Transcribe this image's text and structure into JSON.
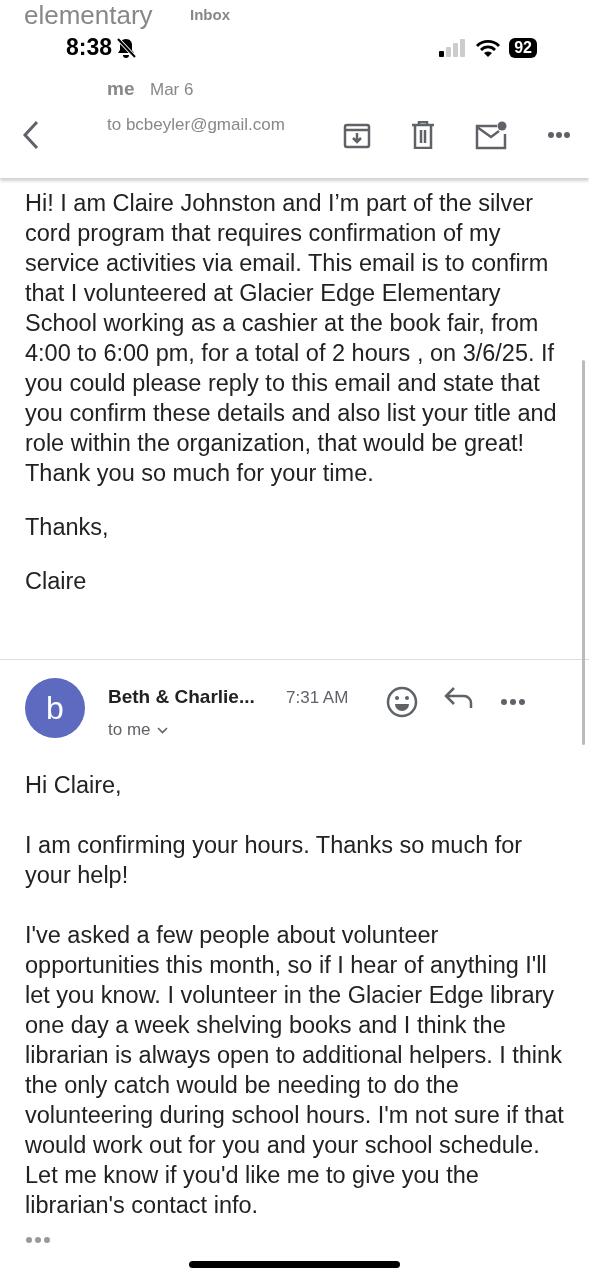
{
  "background_header": {
    "title": "elementary",
    "label": "Inbox",
    "sender": "me",
    "date": "Mar 6",
    "recipient": "to bcbeyler@gmail.com"
  },
  "status_bar": {
    "time": "8:38",
    "battery": "92"
  },
  "first_message": {
    "paragraphs": [
      "Hi! I am Claire Johnston and I’m part of the silver cord program that requires confirmation of my service activities via email. This email is to confirm that I volunteered at Glacier Edge Elementary School working as a cashier at the book fair, from 4:00 to 6:00 pm, for a total of 2 hours , on 3/6/25. If you could please reply to this email and state that you confirm these details and also list your title and role within the organization, that would be great! Thank you so much for your time.",
      "Thanks,",
      "Claire"
    ]
  },
  "reply": {
    "avatar_letter": "b",
    "sender": "Beth & Charlie...",
    "time": "7:31 AM",
    "recipient": "to me",
    "paragraphs": [
      "Hi Claire,",
      "I am confirming your hours.  Thanks so much for your help!",
      "I've asked a few people about volunteer opportunities this month, so if I hear of anything I'll let you know.  I volunteer in the Glacier Edge library one day a week shelving books and I think the librarian is always open to additional helpers.  I think the only catch would be needing to do the volunteering during school hours.  I'm not sure if that would work out for you and your school schedule.  Let me know if you'd like me to give you the librarian's contact info."
    ]
  }
}
